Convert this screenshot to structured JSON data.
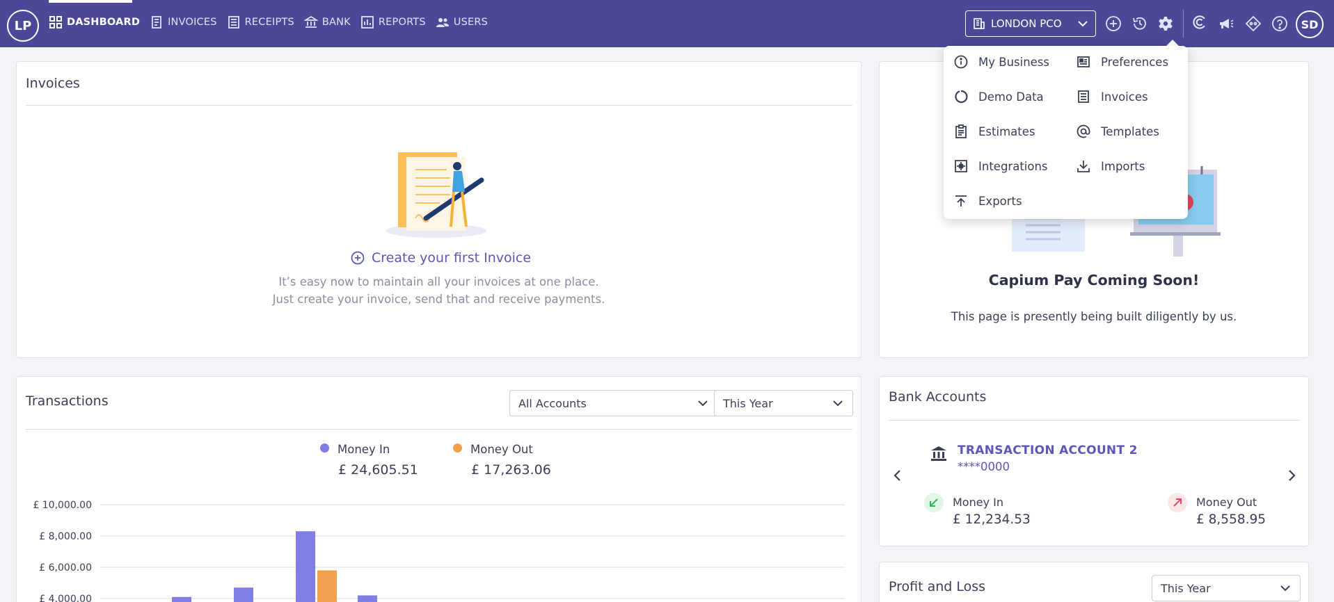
{
  "app": {
    "logo_text": "LP",
    "user_initials": "SD",
    "brand_color": "#4b4898"
  },
  "nav": {
    "items": [
      {
        "label": "DASHBOARD",
        "icon": "dashboard-icon"
      },
      {
        "label": "INVOICES",
        "icon": "invoice-icon"
      },
      {
        "label": "RECEIPTS",
        "icon": "receipt-icon"
      },
      {
        "label": "BANK",
        "icon": "bank-icon"
      },
      {
        "label": "REPORTS",
        "icon": "reports-icon"
      },
      {
        "label": "USERS",
        "icon": "users-icon"
      }
    ],
    "active": "DASHBOARD"
  },
  "company": {
    "name": "LONDON PCO"
  },
  "toolbar_icons": [
    "add-circle-icon",
    "history-icon",
    "gear-icon",
    "capium-icon",
    "announcement-icon",
    "diamond-icon",
    "help-icon"
  ],
  "settings_menu": {
    "items": [
      {
        "label": "My Business",
        "icon": "info-icon"
      },
      {
        "label": "Preferences",
        "icon": "preferences-icon"
      },
      {
        "label": "Demo Data",
        "icon": "demo-data-icon"
      },
      {
        "label": "Invoices",
        "icon": "invoice-icon"
      },
      {
        "label": "Estimates",
        "icon": "clipboard-icon"
      },
      {
        "label": "Templates",
        "icon": "at-icon"
      },
      {
        "label": "Integrations",
        "icon": "integrations-icon"
      },
      {
        "label": "Imports",
        "icon": "download-icon"
      },
      {
        "label": "Exports",
        "icon": "upload-icon"
      }
    ]
  },
  "invoices_card": {
    "title": "Invoices",
    "create_label": "Create your first Invoice",
    "desc_line1": "It’s easy now to maintain all your invoices at one place.",
    "desc_line2": "Just create your invoice, send that and receive payments."
  },
  "capium_card": {
    "title": "Capium Pay Coming Soon!",
    "desc": "This page is presently being built diligently by us."
  },
  "transactions": {
    "title": "Transactions",
    "account_filter": "All Accounts",
    "period_filter": "This Year",
    "money_in_label": "Money In",
    "money_in_value": "£ 24,605.51",
    "money_out_label": "Money Out",
    "money_out_value": "£ 17,263.06",
    "money_in_color": "#7f7ee6",
    "money_out_color": "#f2a04d"
  },
  "chart_data": {
    "type": "bar",
    "y_ticks": [
      "£ 10,000.00",
      "£ 8,000.00",
      "£ 6,000.00",
      "£ 4,000.00"
    ],
    "ylim": [
      0,
      10000
    ],
    "series": [
      {
        "name": "Money In",
        "values": [
          4100,
          4700,
          8300,
          4200
        ]
      },
      {
        "name": "Money Out",
        "values": [
          null,
          null,
          5800,
          null
        ]
      }
    ]
  },
  "bank_accounts": {
    "title": "Bank Accounts",
    "account_name": "TRANSACTION ACCOUNT 2",
    "account_number": "****0000",
    "money_in_label": "Money In",
    "money_in_value": "£ 12,234.53",
    "money_out_label": "Money Out",
    "money_out_value": "£ 8,558.95"
  },
  "profit_loss": {
    "title": "Profit and Loss",
    "period_filter": "This Year"
  }
}
